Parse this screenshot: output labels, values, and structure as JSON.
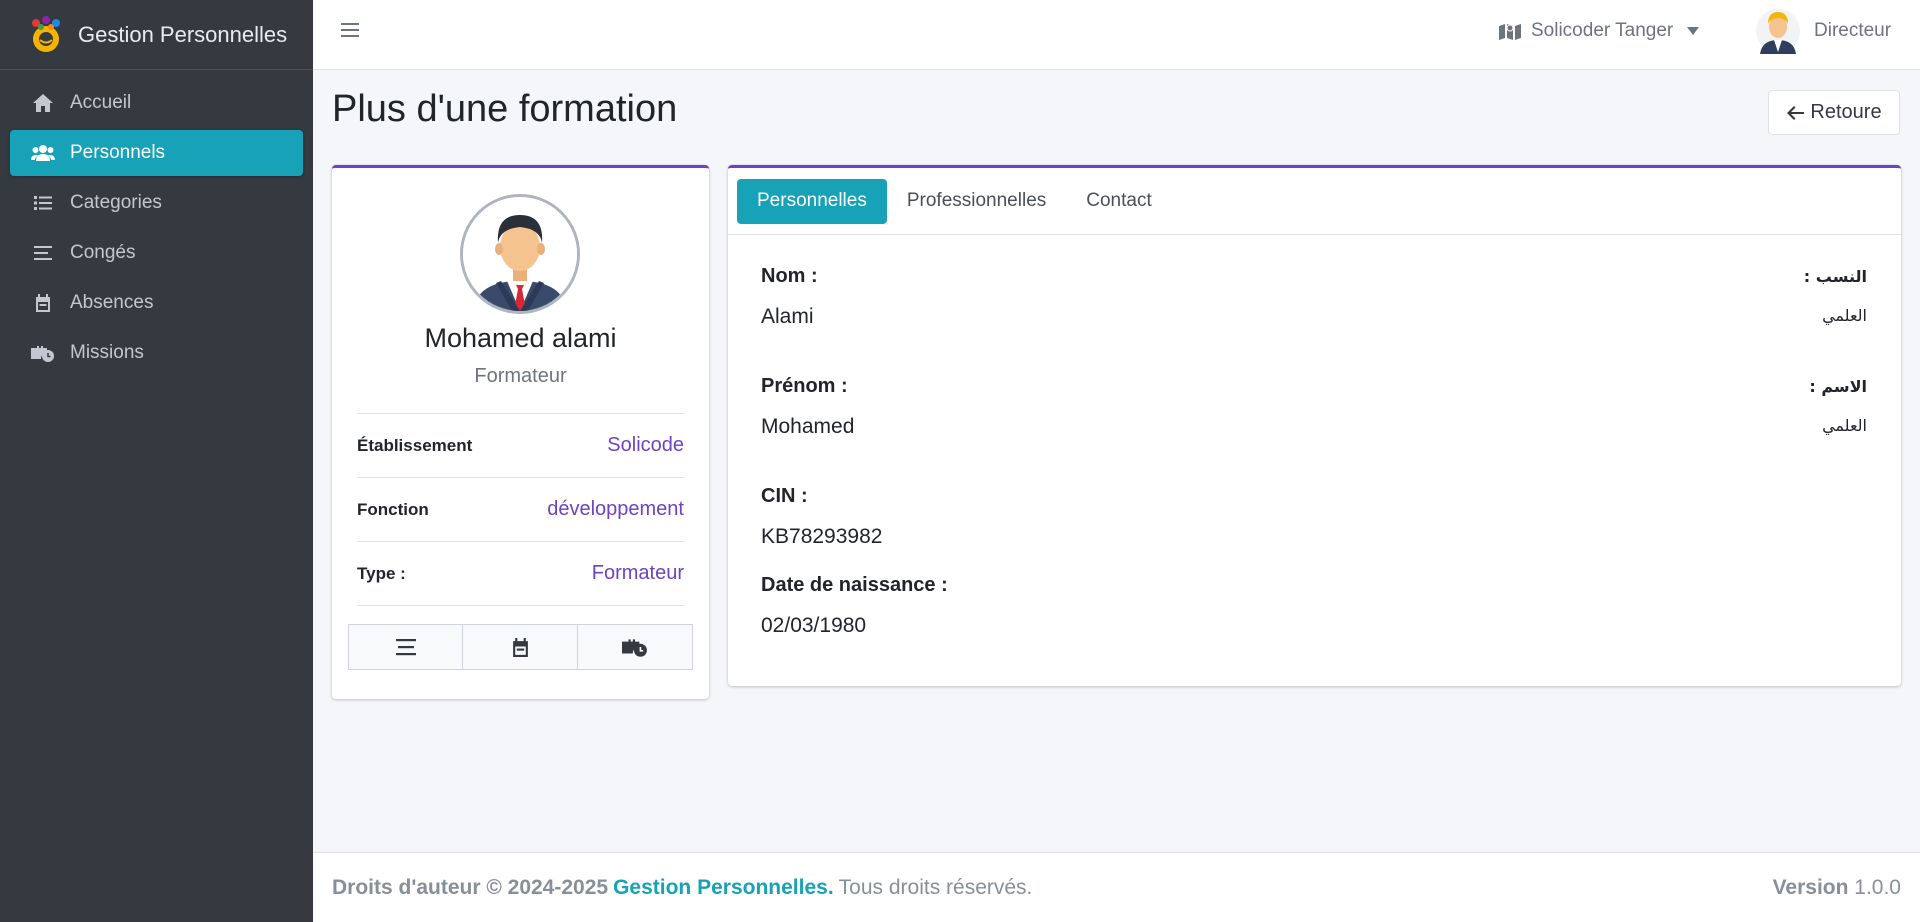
{
  "app": {
    "brand": "Gestion Personnelles"
  },
  "sidebar": {
    "items": [
      {
        "label": "Accueil",
        "icon": "home-icon"
      },
      {
        "label": "Personnels",
        "icon": "users-icon",
        "active": true
      },
      {
        "label": "Categories",
        "icon": "list-icon"
      },
      {
        "label": "Congés",
        "icon": "bars-icon"
      },
      {
        "label": "Absences",
        "icon": "calendar-icon"
      },
      {
        "label": "Missions",
        "icon": "briefcase-clock-icon"
      }
    ]
  },
  "topbar": {
    "company": "Solicoder Tanger",
    "user_role": "Directeur"
  },
  "page": {
    "title": "Plus d'une formation",
    "back_label": "Retoure"
  },
  "profile": {
    "name": "Mohamed alami",
    "role": "Formateur",
    "info": [
      {
        "label": "Établissement",
        "value": "Solicode"
      },
      {
        "label": "Fonction",
        "value": "développement"
      },
      {
        "label": "Type :",
        "value": "Formateur"
      }
    ],
    "actions": [
      "bars-icon",
      "calendar-icon",
      "briefcase-clock-icon"
    ]
  },
  "details": {
    "tabs": [
      "Personnelles",
      "Professionnelles",
      "Contact"
    ],
    "active_tab": "Personnelles",
    "fields": {
      "nom_label": "Nom :",
      "nom_value": "Alami",
      "nom_ar_label": "النسب :",
      "nom_ar_value": "العلمي",
      "prenom_label": "Prénom :",
      "prenom_value": "Mohamed",
      "prenom_ar_label": "الاسم :",
      "prenom_ar_value": "العلمي",
      "cin_label": "CIN :",
      "cin_value": "KB78293982",
      "dob_label": "Date de naissance :",
      "dob_value": "02/03/1980"
    }
  },
  "footer": {
    "copyright": "Droits d'auteur © 2024-2025",
    "brand": "Gestion Personnelles.",
    "rights": "Tous droits réservés.",
    "version_label": "Version",
    "version_value": "1.0.0"
  },
  "colors": {
    "sidebar_bg": "#343a40",
    "accent_teal": "#17a2b8",
    "accent_purple": "#6f42c1"
  }
}
